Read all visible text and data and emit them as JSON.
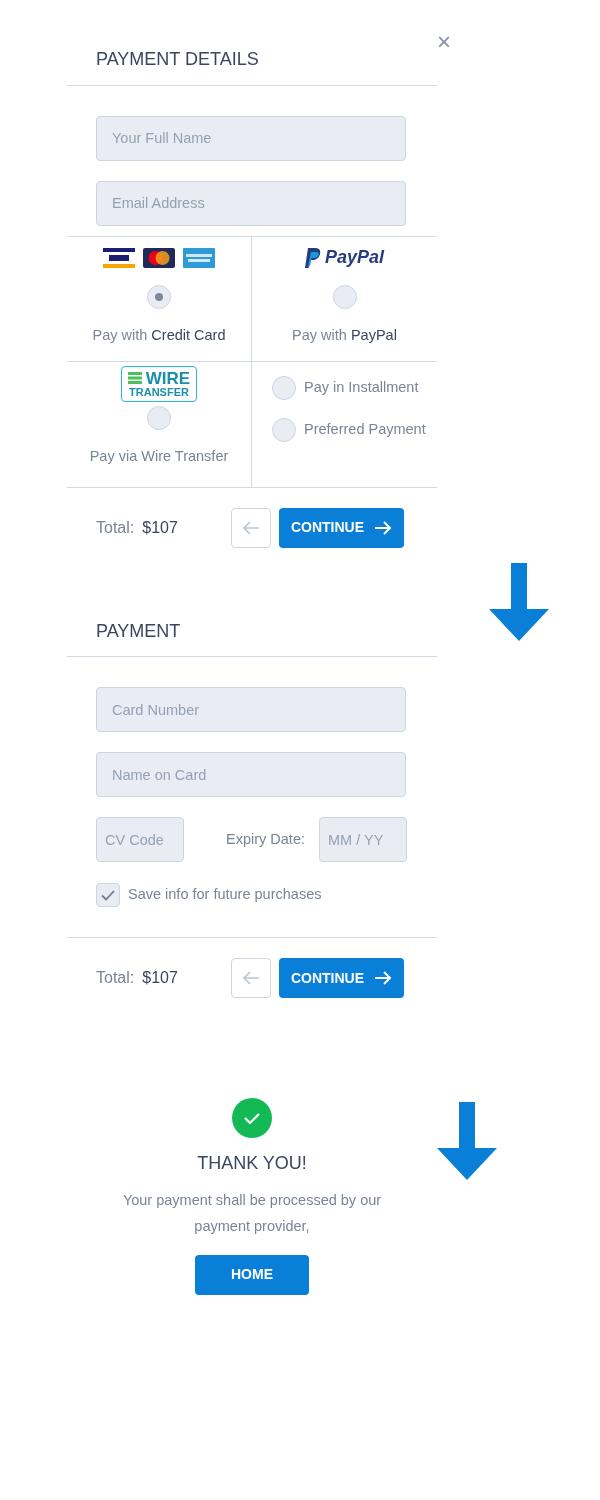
{
  "close": "×",
  "details": {
    "title": "PAYMENT DETAILS",
    "fields": [
      {
        "placeholder": "Your Full Name"
      },
      {
        "placeholder": "Email Address"
      }
    ],
    "methods": [
      {
        "kind": "cards",
        "label": "Pay with **Credit Card**",
        "selected": true
      },
      {
        "kind": "paypal",
        "logo": "PayPal",
        "label": "Pay with **PayPal**",
        "selected": false
      },
      {
        "kind": "wire",
        "logo_top": "WIRE",
        "logo_bottom": "TRANSFER",
        "label": "Pay via Wire Transfer",
        "selected": false
      },
      {
        "kind": "options",
        "options": [
          {
            "label": "Pay in Installment",
            "selected": false
          },
          {
            "label": "Preferred Payment",
            "selected": false
          }
        ]
      }
    ],
    "footer": {
      "total_label": "Total:",
      "total": "$107",
      "continue": "CONTINUE"
    }
  },
  "payment": {
    "title": "PAYMENT",
    "fields": [
      {
        "placeholder": "Card Number"
      },
      {
        "placeholder": "Name on Card"
      }
    ],
    "cv": {
      "placeholder": "CV Code"
    },
    "expiry_label": "Expiry Date:",
    "expiry": {
      "placeholder": "MM / YY"
    },
    "save": {
      "label": "Save info for future purchases",
      "checked": true
    },
    "footer": {
      "total_label": "Total:",
      "total": "$107",
      "continue": "CONTINUE"
    }
  },
  "thanks": {
    "title": "THANK YOU!",
    "message": "Your payment shall be processed by our payment provider,",
    "button": "HOME"
  }
}
